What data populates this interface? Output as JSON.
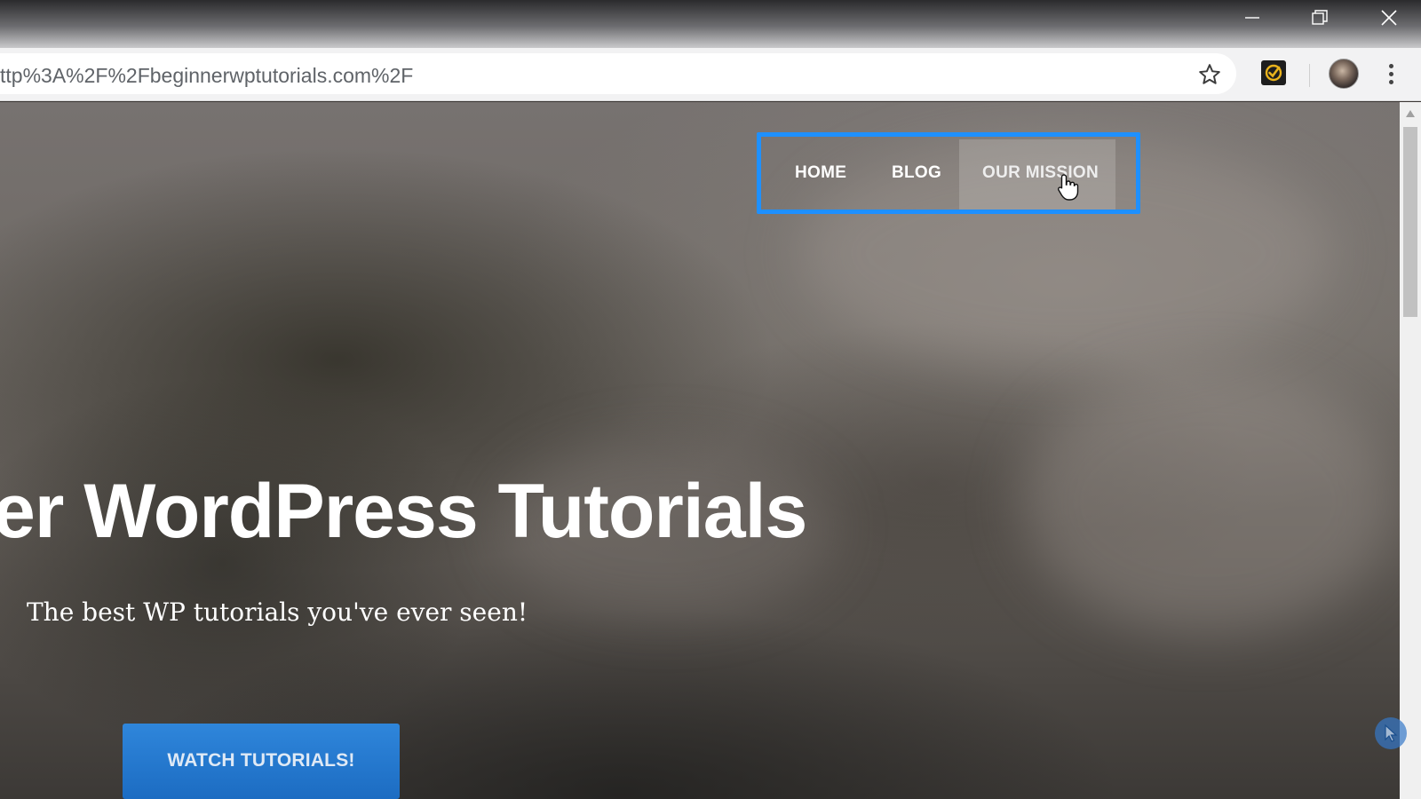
{
  "browser": {
    "url": "ttp%3A%2F%2Fbeginnerwptutorials.com%2F",
    "window_controls": [
      "minimize-icon",
      "restore-icon",
      "close-icon"
    ],
    "toolbar_icons": [
      "bookmark-star-icon",
      "extension-checkmark-icon",
      "profile-avatar",
      "menu-kebab-icon"
    ]
  },
  "site": {
    "nav": {
      "items": [
        {
          "label": "HOME"
        },
        {
          "label": "BLOG"
        },
        {
          "label": "OUR MISSION"
        }
      ],
      "hovered_item": "OUR MISSION",
      "highlight_color": "#1e90ff"
    },
    "hero": {
      "title": "er WordPress Tutorials",
      "subtitle": "The best WP tutorials you've ever seen!",
      "cta_label": "WATCH TUTORIALS!",
      "cta_color": "#2a7fd6"
    }
  }
}
